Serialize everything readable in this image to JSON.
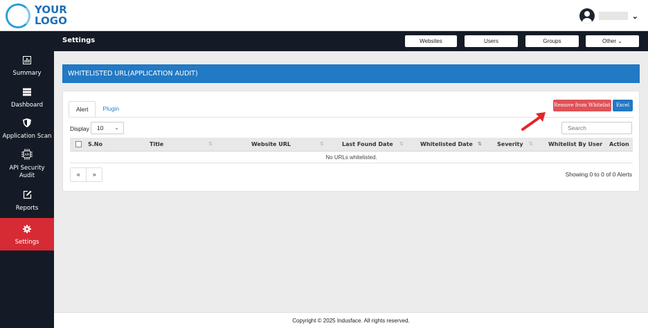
{
  "logo": {
    "line1": "YOUR",
    "line2": "LOGO"
  },
  "header": {
    "title": "Settings",
    "buttons": [
      "Websites",
      "Users",
      "Groups",
      "Other"
    ],
    "other_chevron": "⌄"
  },
  "sidebar": {
    "items": [
      {
        "label": "Summary",
        "icon": "summary-chart-icon"
      },
      {
        "label": "Dashboard",
        "icon": "server-stack-icon"
      },
      {
        "label": "Application Scan",
        "icon": "shield-icon"
      },
      {
        "label": "API Security Audit",
        "icon": "api-chip-icon"
      },
      {
        "label": "Reports",
        "icon": "edit-icon"
      },
      {
        "label": "Settings",
        "icon": "gear-icon",
        "active": true
      }
    ]
  },
  "banner": {
    "title": "WHITELISTED URL(APPLICATION AUDIT)"
  },
  "tabs": [
    {
      "label": "Alert",
      "active": true
    },
    {
      "label": "Plugin",
      "active": false
    }
  ],
  "actions": {
    "remove_label": "Remove from Whitelist",
    "excel_label": "Excel"
  },
  "controls": {
    "display_label": "Display",
    "page_size": "10",
    "search_placeholder": "Search"
  },
  "table": {
    "columns": [
      "S.No",
      "Title",
      "Website URL",
      "Last Found Date",
      "Whitelisted Date",
      "Severity",
      "Whitelist By User",
      "Action"
    ],
    "empty_message": "No URLs whitelisted."
  },
  "pagination": {
    "prev": "«",
    "next": "»",
    "summary": "Showing 0 to 0 of 0 Alerts"
  },
  "footer": {
    "text": "Copyright © 2025 Indusface. All rights reserved."
  },
  "colors": {
    "accent": "#2279c4",
    "danger": "#e05157",
    "sidebar": "#151b26",
    "active": "#d62a35"
  }
}
